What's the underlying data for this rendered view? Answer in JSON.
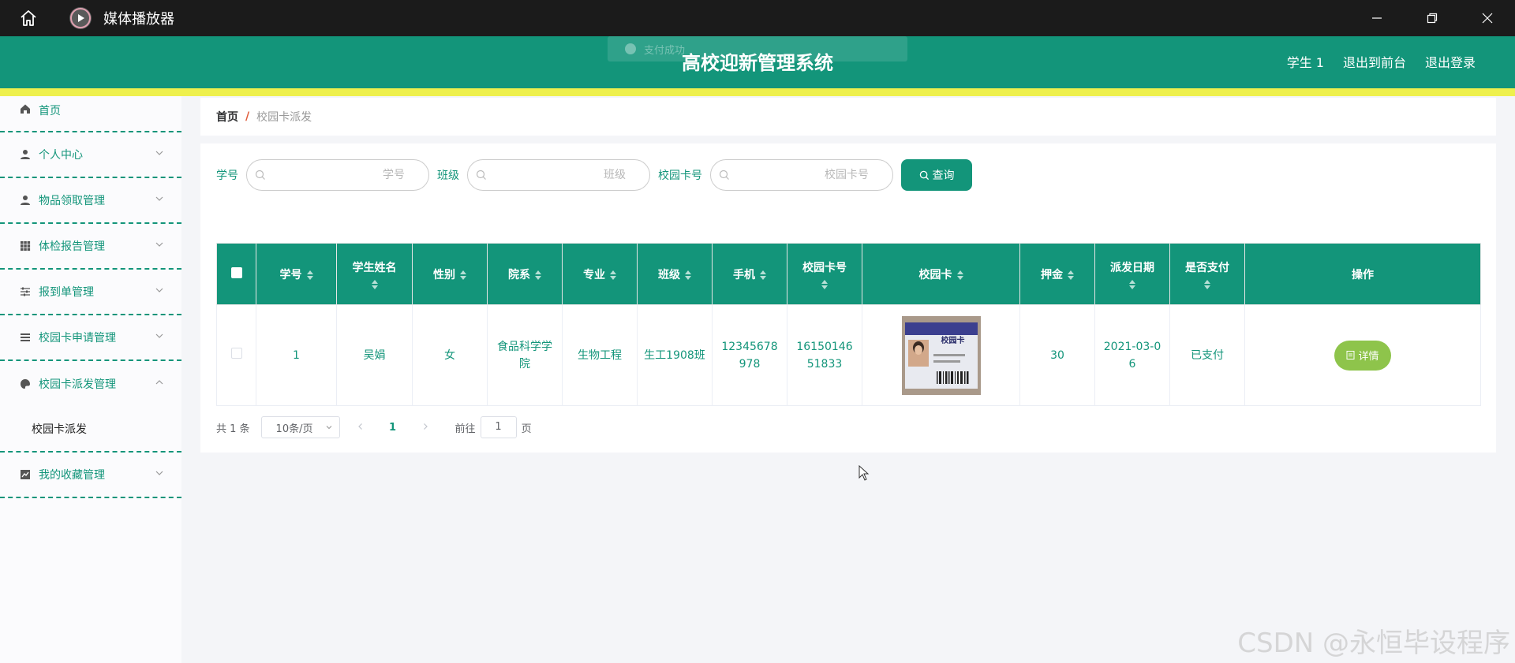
{
  "window": {
    "title": "媒体播放器"
  },
  "toast": {
    "text": "支付成功"
  },
  "header": {
    "title": "高校迎新管理系统",
    "links": [
      "学生 1",
      "退出到前台",
      "退出登录"
    ]
  },
  "sidebar": {
    "items": [
      {
        "label": "首页",
        "icon": "home-icon"
      },
      {
        "label": "个人中心",
        "icon": "user-icon"
      },
      {
        "label": "物品领取管理",
        "icon": "user-icon"
      },
      {
        "label": "体检报告管理",
        "icon": "grid-icon"
      },
      {
        "label": "报到单管理",
        "icon": "sliders-icon"
      },
      {
        "label": "校园卡申请管理",
        "icon": "list-icon"
      },
      {
        "label": "校园卡派发管理",
        "icon": "palette-icon"
      },
      {
        "label": "我的收藏管理",
        "icon": "chart-icon"
      }
    ],
    "submenu": [
      "校园卡派发"
    ]
  },
  "breadcrumb": {
    "home": "首页",
    "separator": "/",
    "current": "校园卡派发"
  },
  "search": {
    "fields": [
      {
        "label": "学号",
        "placeholder": "学号"
      },
      {
        "label": "班级",
        "placeholder": "班级"
      },
      {
        "label": "校园卡号",
        "placeholder": "校园卡号"
      }
    ],
    "button": "查询"
  },
  "table": {
    "headers": [
      "学号",
      "学生姓名",
      "性别",
      "院系",
      "专业",
      "班级",
      "手机",
      "校园卡号",
      "校园卡",
      "押金",
      "派发日期",
      "是否支付",
      "操作"
    ],
    "rows": [
      {
        "student_id": "1",
        "name": "吴娟",
        "gender": "女",
        "dept": "食品科学学院",
        "major": "生物工程",
        "class": "生工1908班",
        "phone": "12345678978",
        "card_no": "1615014651833",
        "card_image_caption": "校园卡",
        "deposit": "30",
        "date": "2021-03-06",
        "paid": "已支付",
        "action": "详情"
      }
    ]
  },
  "pagination": {
    "total": "共 1 条",
    "page_size": "10条/页",
    "current_page": "1",
    "goto_label": "前往",
    "goto_value": "1",
    "page_suffix": "页"
  },
  "watermark": "CSDN @永恒毕设程序",
  "colors": {
    "primary": "#13957a",
    "accent_stripe": "#eef04d",
    "detail_button": "#8ec44b",
    "titlebar": "#1b1b1b"
  }
}
